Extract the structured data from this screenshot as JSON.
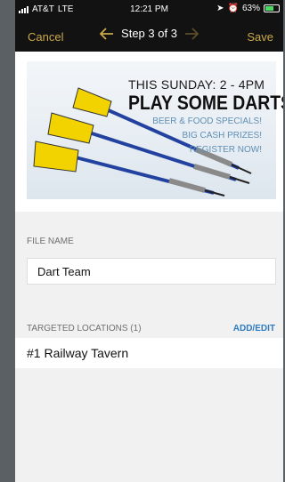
{
  "status_bar": {
    "carrier": "AT&T",
    "network": "LTE",
    "time": "12:21 PM",
    "battery": "63%",
    "battery_level": 0.63
  },
  "nav": {
    "cancel_label": "Cancel",
    "title": "Step 3 of 3",
    "save_label": "Save",
    "accent_color": "#c9a94a"
  },
  "banner": {
    "line1": "THIS SUNDAY: 2 - 4PM",
    "line2": "PLAY SOME DARTS!",
    "line3": "BEER & FOOD SPECIALS!",
    "line4": "BIG CASH PRIZES!",
    "line5": "REGISTER NOW!"
  },
  "file_name": {
    "label": "FILE NAME",
    "value": "Dart Team"
  },
  "targeted_locations": {
    "label": "TARGETED LOCATIONS (1)",
    "action_label": "ADD/EDIT",
    "items": [
      "#1 Railway Tavern"
    ]
  }
}
